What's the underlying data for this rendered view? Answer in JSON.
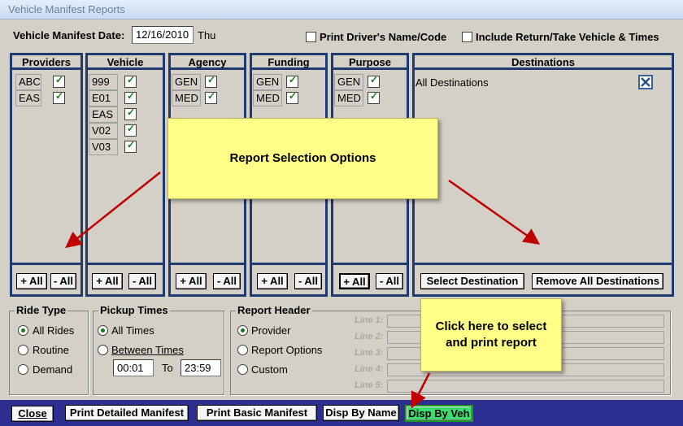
{
  "window": {
    "title": "Vehicle Manifest Reports"
  },
  "header": {
    "date_label": "Vehicle Manifest Date:",
    "date_value": "12/16/2010",
    "day": "Thu",
    "print_driver_label": "Print Driver's Name/Code",
    "include_return_label": "Include Return/Take Vehicle & Times"
  },
  "panels": {
    "providers": {
      "title": "Providers",
      "items": [
        "ABC",
        "EAS"
      ]
    },
    "vehicle": {
      "title": "Vehicle",
      "items": [
        "999",
        "E01",
        "EAS",
        "V02",
        "V03"
      ]
    },
    "agency": {
      "title": "Agency",
      "items": [
        "GEN",
        "MED"
      ]
    },
    "funding": {
      "title": "Funding",
      "items": [
        "GEN",
        "MED"
      ]
    },
    "purpose": {
      "title": "Purpose",
      "items": [
        "GEN",
        "MED"
      ]
    },
    "destinations": {
      "title": "Destinations",
      "item": "All Destinations"
    }
  },
  "buttons": {
    "plus_all": "+ All",
    "minus_all": "- All",
    "select_destination": "Select Destination",
    "remove_all_destinations": "Remove All Destinations"
  },
  "ride_type": {
    "title": "Ride Type",
    "options": [
      "All Rides",
      "Routine",
      "Demand"
    ],
    "selected": "All Rides"
  },
  "pickup_times": {
    "title": "Pickup Times",
    "options": [
      "All Times",
      "Between Times"
    ],
    "from": "00:01",
    "to_label": "To",
    "to": "23:59"
  },
  "report_header": {
    "title": "Report Header",
    "options": [
      "Provider",
      "Report Options",
      "Custom"
    ],
    "lines": [
      "Line 1:",
      "Line 2:",
      "Line 3:",
      "Line 4:",
      "Line 5:"
    ]
  },
  "annotations": {
    "selection_note": "Report Selection Options",
    "click_note_1": "Click here to select",
    "click_note_2": "and print report"
  },
  "bottom": {
    "close": "Close",
    "print_detailed": "Print Detailed Manifest",
    "print_basic": "Print Basic Manifest",
    "disp_by_name": "Disp By Name",
    "disp_by_veh": "Disp By Veh"
  },
  "colors": {
    "panel_border": "#1e3a6e",
    "note_bg": "#ffff88",
    "arrow": "#c00000",
    "bottom_bar": "#2c2f8f",
    "highlight_button": "#3ddc6e"
  }
}
